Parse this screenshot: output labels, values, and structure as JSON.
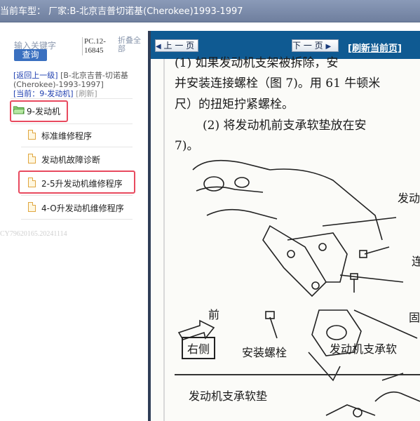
{
  "window": {
    "title": "当前车型： 厂家:B-北京吉普切诺基(Cherokee)1993-1997"
  },
  "sidebar": {
    "search_placeholder": "输入关键字",
    "search_button": "查询",
    "pc_code": "PC.12-16845",
    "collapse_all": "折叠全部",
    "nav_back": "[返回上一级]",
    "nav_path": "[B-北京吉普-切诺基(Cherokee)-1993-1997]",
    "nav_current": "[当前：9-发动机]",
    "nav_refresh": "[刷新]",
    "tree": [
      {
        "label": "9-发动机",
        "type": "folder",
        "highlighted": true
      },
      {
        "label": "标准维修程序",
        "type": "doc",
        "highlighted": false
      },
      {
        "label": "发动机故障诊断",
        "type": "doc",
        "highlighted": false
      },
      {
        "label": "2-5升发动机维修程序",
        "type": "doc",
        "highlighted": true
      },
      {
        "label": "4-O升发动机维修程序",
        "type": "doc",
        "highlighted": false
      }
    ],
    "watermark": "CY79620165.20241114"
  },
  "toolbar": {
    "prev_label": "上 一 页",
    "next_label": "下 一 页",
    "refresh_label": "[刷新当前页]"
  },
  "document": {
    "lines": [
      "(1) 如果发动机支架被拆除，安",
      "并安装连接螺栓（图 7)。用 61 牛顿米",
      "尺）的扭矩拧紧螺栓。",
      "(2) 将发动机前支承软垫放在安",
      "7)。"
    ],
    "labels": {
      "engine": "发动",
      "connect": "连",
      "front": "前",
      "fix": "固",
      "right_side": "右侧",
      "install_bolt": "安装螺栓",
      "support": "发动机支承软",
      "pad": "发动机支承软垫"
    }
  },
  "colors": {
    "title_bar": "#7a8aa8",
    "toolbar": "#0f5a92",
    "splitter": "#2f3e57",
    "highlight": "#e84a5f",
    "link": "#1f3fb0",
    "search_button": "#3a70c0"
  }
}
